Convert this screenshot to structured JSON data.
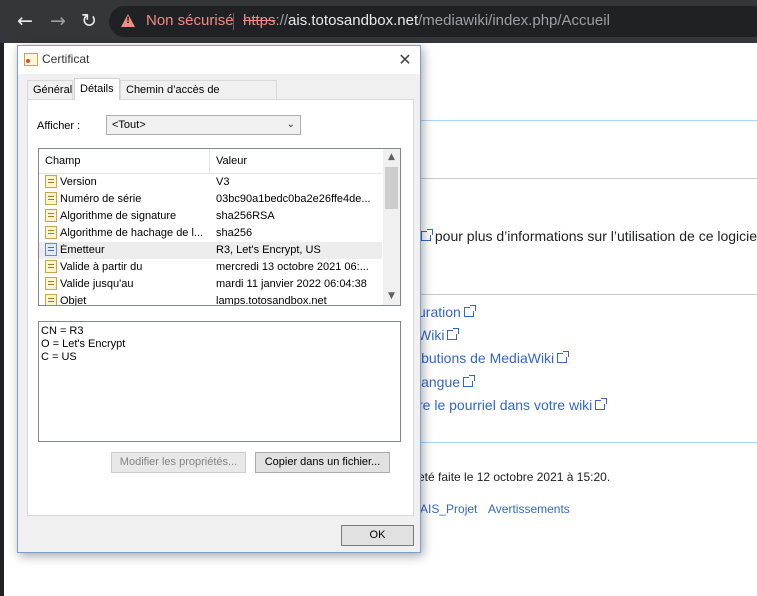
{
  "browser": {
    "back_glyph": "←",
    "forward_glyph": "→",
    "reload_glyph": "↻",
    "security_label": "Non sécurisé",
    "url_scheme": "https",
    "url_sep": "://",
    "url_host": "ais.totosandbox.net",
    "url_path": "/mediawiki/index.php/Accueil"
  },
  "wiki": {
    "info_text": "pour plus d’informations sur l’utilisation de ce logiciel",
    "links": [
      "uration",
      "Wiki",
      "ibutions de MediaWiki",
      "langue",
      "re le pourriel dans votre wiki"
    ],
    "footer_modified": "eté faite le 12 octobre 2021 à 15:20.",
    "footer_link_project": "AIS_Projet",
    "footer_link_disclaimer": "Avertissements"
  },
  "dialog": {
    "title": "Certificat",
    "close_glyph": "✕",
    "tabs": [
      {
        "label": "Général"
      },
      {
        "label": "Détails"
      },
      {
        "label": "Chemin d’accès de certification"
      }
    ],
    "show_label": "Afficher :",
    "show_value": "<Tout>",
    "chevron_glyph": "⌄",
    "columns": {
      "field": "Champ",
      "value": "Valeur"
    },
    "rows": [
      {
        "field": "Version",
        "value": "V3"
      },
      {
        "field": "Numéro de série",
        "value": "03bc90a1bedc0ba2e26ffe4de..."
      },
      {
        "field": "Algorithme de signature",
        "value": "sha256RSA"
      },
      {
        "field": "Algorithme de hachage de l...",
        "value": "sha256"
      },
      {
        "field": "Émetteur",
        "value": "R3, Let's Encrypt, US"
      },
      {
        "field": "Valide à partir du",
        "value": "mercredi 13 octobre 2021 06:..."
      },
      {
        "field": "Valide jusqu'au",
        "value": "mardi 11 janvier 2022 06:04:38"
      },
      {
        "field": "Objet",
        "value": "lamps.totosandbox.net"
      }
    ],
    "selected_row": 4,
    "scroll_up_glyph": "▲",
    "scroll_down_glyph": "▼",
    "detail_lines": [
      "CN = R3",
      "O = Let's Encrypt",
      "C = US"
    ],
    "buttons": {
      "edit_properties": "Modifier les propriétés...",
      "copy_to_file": "Copier dans un fichier...",
      "ok": "OK"
    }
  }
}
